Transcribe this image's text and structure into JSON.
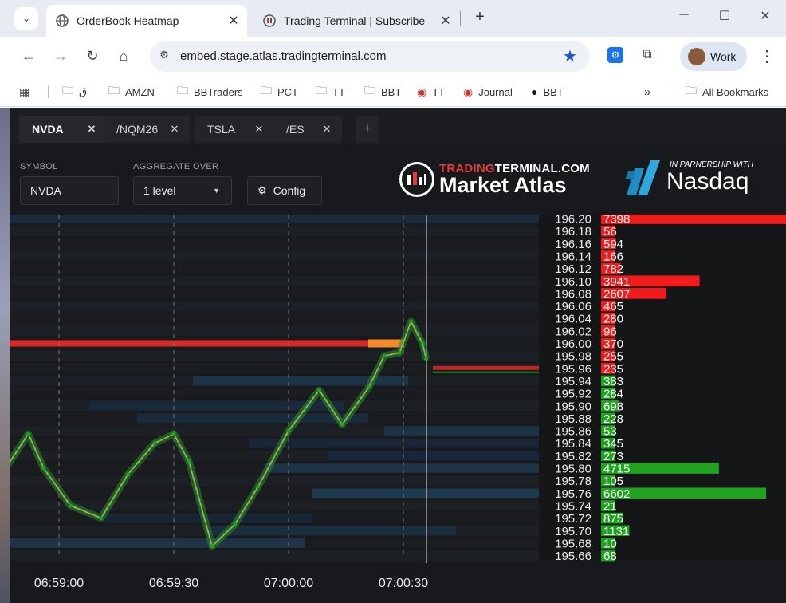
{
  "browser": {
    "tabs": [
      {
        "title": "OrderBook Heatmap",
        "icon": "globe-icon",
        "active": true
      },
      {
        "title": "Trading Terminal | Subscribe",
        "icon": "trading-terminal-icon",
        "active": false
      }
    ],
    "url": "embed.stage.atlas.tradingterminal.com",
    "profile_label": "Work",
    "bookmarks": [
      {
        "label": "ق",
        "icon": "folder-icon"
      },
      {
        "label": "AMZN",
        "icon": "folder-icon"
      },
      {
        "label": "BBTraders",
        "icon": "folder-icon"
      },
      {
        "label": "PCT",
        "icon": "folder-icon"
      },
      {
        "label": "TT",
        "icon": "folder-icon"
      },
      {
        "label": "BBT",
        "icon": "folder-icon"
      },
      {
        "label": "TT",
        "icon": "trading-terminal-icon"
      },
      {
        "label": "Journal",
        "icon": "trading-terminal-icon"
      },
      {
        "label": "BBT",
        "icon": "bbt-icon"
      }
    ],
    "more_label": "»",
    "all_bookmarks_label": "All Bookmarks"
  },
  "app": {
    "tabs": [
      {
        "label": "NVDA",
        "active": true
      },
      {
        "label": "/NQM26",
        "active": false
      },
      {
        "label": "TSLA",
        "active": false
      },
      {
        "label": "/ES",
        "active": false
      }
    ],
    "add_tab_label": "+",
    "symbol_label": "SYMBOL",
    "symbol_value": "NVDA",
    "aggregate_label": "AGGREGATE OVER",
    "aggregate_value": "1 level",
    "config_label": "Config",
    "brand": {
      "tt_sub_red": "TRADING",
      "tt_sub_white": "TERMINAL.COM",
      "tt_main": "Market Atlas",
      "partner_line": "IN PARNERSHIP WITH",
      "partner_name": "Nasdaq"
    },
    "colors": {
      "bid": "#1fa31f",
      "ask": "#f01c1c",
      "background": "#17191c"
    }
  },
  "chart_data": {
    "type": "heatmap",
    "x_ticks": [
      "06:59:00",
      "06:59:30",
      "07:00:00",
      "07:00:30"
    ],
    "price_range": [
      195.66,
      196.2
    ],
    "book": [
      {
        "price": "196.20",
        "size": 7398,
        "side": "ask"
      },
      {
        "price": "196.18",
        "size": 56,
        "side": "ask"
      },
      {
        "price": "196.16",
        "size": 594,
        "side": "ask"
      },
      {
        "price": "196.14",
        "size": 166,
        "side": "ask"
      },
      {
        "price": "196.12",
        "size": 782,
        "side": "ask"
      },
      {
        "price": "196.10",
        "size": 3941,
        "side": "ask"
      },
      {
        "price": "196.08",
        "size": 2607,
        "side": "ask"
      },
      {
        "price": "196.06",
        "size": 465,
        "side": "ask"
      },
      {
        "price": "196.04",
        "size": 280,
        "side": "ask"
      },
      {
        "price": "196.02",
        "size": 96,
        "side": "ask"
      },
      {
        "price": "196.00",
        "size": 370,
        "side": "ask"
      },
      {
        "price": "195.98",
        "size": 255,
        "side": "ask"
      },
      {
        "price": "195.96",
        "size": 235,
        "side": "ask"
      },
      {
        "price": "195.94",
        "size": 383,
        "side": "bid"
      },
      {
        "price": "195.92",
        "size": 284,
        "side": "bid"
      },
      {
        "price": "195.90",
        "size": 698,
        "side": "bid"
      },
      {
        "price": "195.88",
        "size": 228,
        "side": "bid"
      },
      {
        "price": "195.86",
        "size": 53,
        "side": "bid"
      },
      {
        "price": "195.84",
        "size": 345,
        "side": "bid"
      },
      {
        "price": "195.82",
        "size": 273,
        "side": "bid"
      },
      {
        "price": "195.80",
        "size": 4715,
        "side": "bid"
      },
      {
        "price": "195.78",
        "size": 105,
        "side": "bid"
      },
      {
        "price": "195.76",
        "size": 6602,
        "side": "bid"
      },
      {
        "price": "195.74",
        "size": 21,
        "side": "bid"
      },
      {
        "price": "195.72",
        "size": 875,
        "side": "bid"
      },
      {
        "price": "195.70",
        "size": 1131,
        "side": "bid"
      },
      {
        "price": "195.68",
        "size": 10,
        "side": "bid"
      },
      {
        "price": "195.66",
        "size": 68,
        "side": "bid"
      }
    ],
    "price_path": [
      {
        "t": "06:58:39",
        "p": 195.693
      },
      {
        "t": "06:58:45",
        "p": 195.79
      },
      {
        "t": "06:58:52",
        "p": 195.855
      },
      {
        "t": "06:58:56",
        "p": 195.8
      },
      {
        "t": "06:59:03",
        "p": 195.74
      },
      {
        "t": "06:59:11",
        "p": 195.72
      },
      {
        "t": "06:59:18",
        "p": 195.79
      },
      {
        "t": "06:59:25",
        "p": 195.84
      },
      {
        "t": "06:59:30",
        "p": 195.855
      },
      {
        "t": "06:59:34",
        "p": 195.81
      },
      {
        "t": "06:59:40",
        "p": 195.675
      },
      {
        "t": "06:59:46",
        "p": 195.71
      },
      {
        "t": "06:59:52",
        "p": 195.77
      },
      {
        "t": "07:00:00",
        "p": 195.86
      },
      {
        "t": "07:00:08",
        "p": 195.925
      },
      {
        "t": "07:00:14",
        "p": 195.87
      },
      {
        "t": "07:00:21",
        "p": 195.93
      },
      {
        "t": "07:00:25",
        "p": 195.98
      },
      {
        "t": "07:00:29",
        "p": 195.985
      },
      {
        "t": "07:00:32",
        "p": 196.035
      },
      {
        "t": "07:00:35",
        "p": 196.0
      },
      {
        "t": "07:00:36",
        "p": 195.975
      }
    ]
  }
}
